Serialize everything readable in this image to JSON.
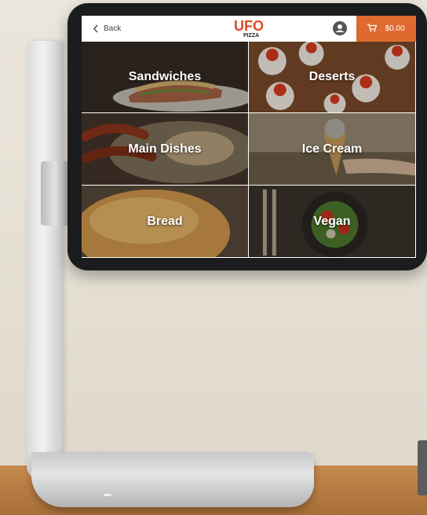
{
  "header": {
    "back_label": "Back",
    "logo_text_main": "UFO",
    "logo_text_sub": "PIZZA",
    "cart_total": "$0.00"
  },
  "categories": [
    {
      "label": "Sandwiches"
    },
    {
      "label": "Deserts"
    },
    {
      "label": "Main Dishes"
    },
    {
      "label": "Ice Cream"
    },
    {
      "label": "Bread"
    },
    {
      "label": "Vegan"
    }
  ],
  "colors": {
    "accent": "#de6a30",
    "logo_red": "#e04a23"
  }
}
